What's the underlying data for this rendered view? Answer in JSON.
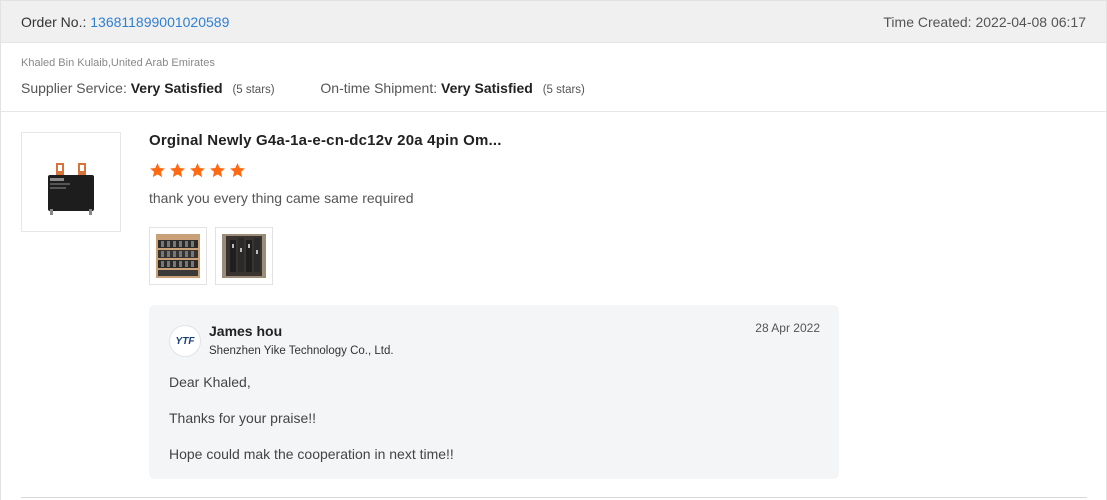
{
  "header": {
    "order_label": "Order No.:",
    "order_number": "136811899001020589",
    "time_created": "Time Created: 2022-04-08 06:17"
  },
  "buyer": {
    "name_location": "Khaled Bin Kulaib,United Arab Emirates",
    "supplier_service_label": "Supplier Service:",
    "supplier_service_value": "Very Satisfied",
    "supplier_service_stars": "(5 stars)",
    "shipment_label": "On-time Shipment:",
    "shipment_value": "Very Satisfied",
    "shipment_stars": "(5 stars)"
  },
  "review": {
    "product_title": "Orginal Newly G4a-1a-e-cn-dc12v 20a 4pin Om...",
    "rating": 5,
    "star_color": "#ff6a14",
    "text": "thank you every thing came same required",
    "photos": [
      "review-photo-1",
      "review-photo-2"
    ]
  },
  "reply": {
    "avatar_text": "YTF",
    "name": "James hou",
    "company": "Shenzhen Yike Technology Co., Ltd.",
    "date": "28 Apr 2022",
    "lines": [
      "Dear Khaled,",
      "Thanks for your praise!!",
      "Hope could mak the cooperation in next time!!"
    ]
  },
  "colors": {
    "link": "#2f7fd2",
    "header_bg": "#f0f0f0",
    "reply_bg": "#f4f5f7"
  }
}
